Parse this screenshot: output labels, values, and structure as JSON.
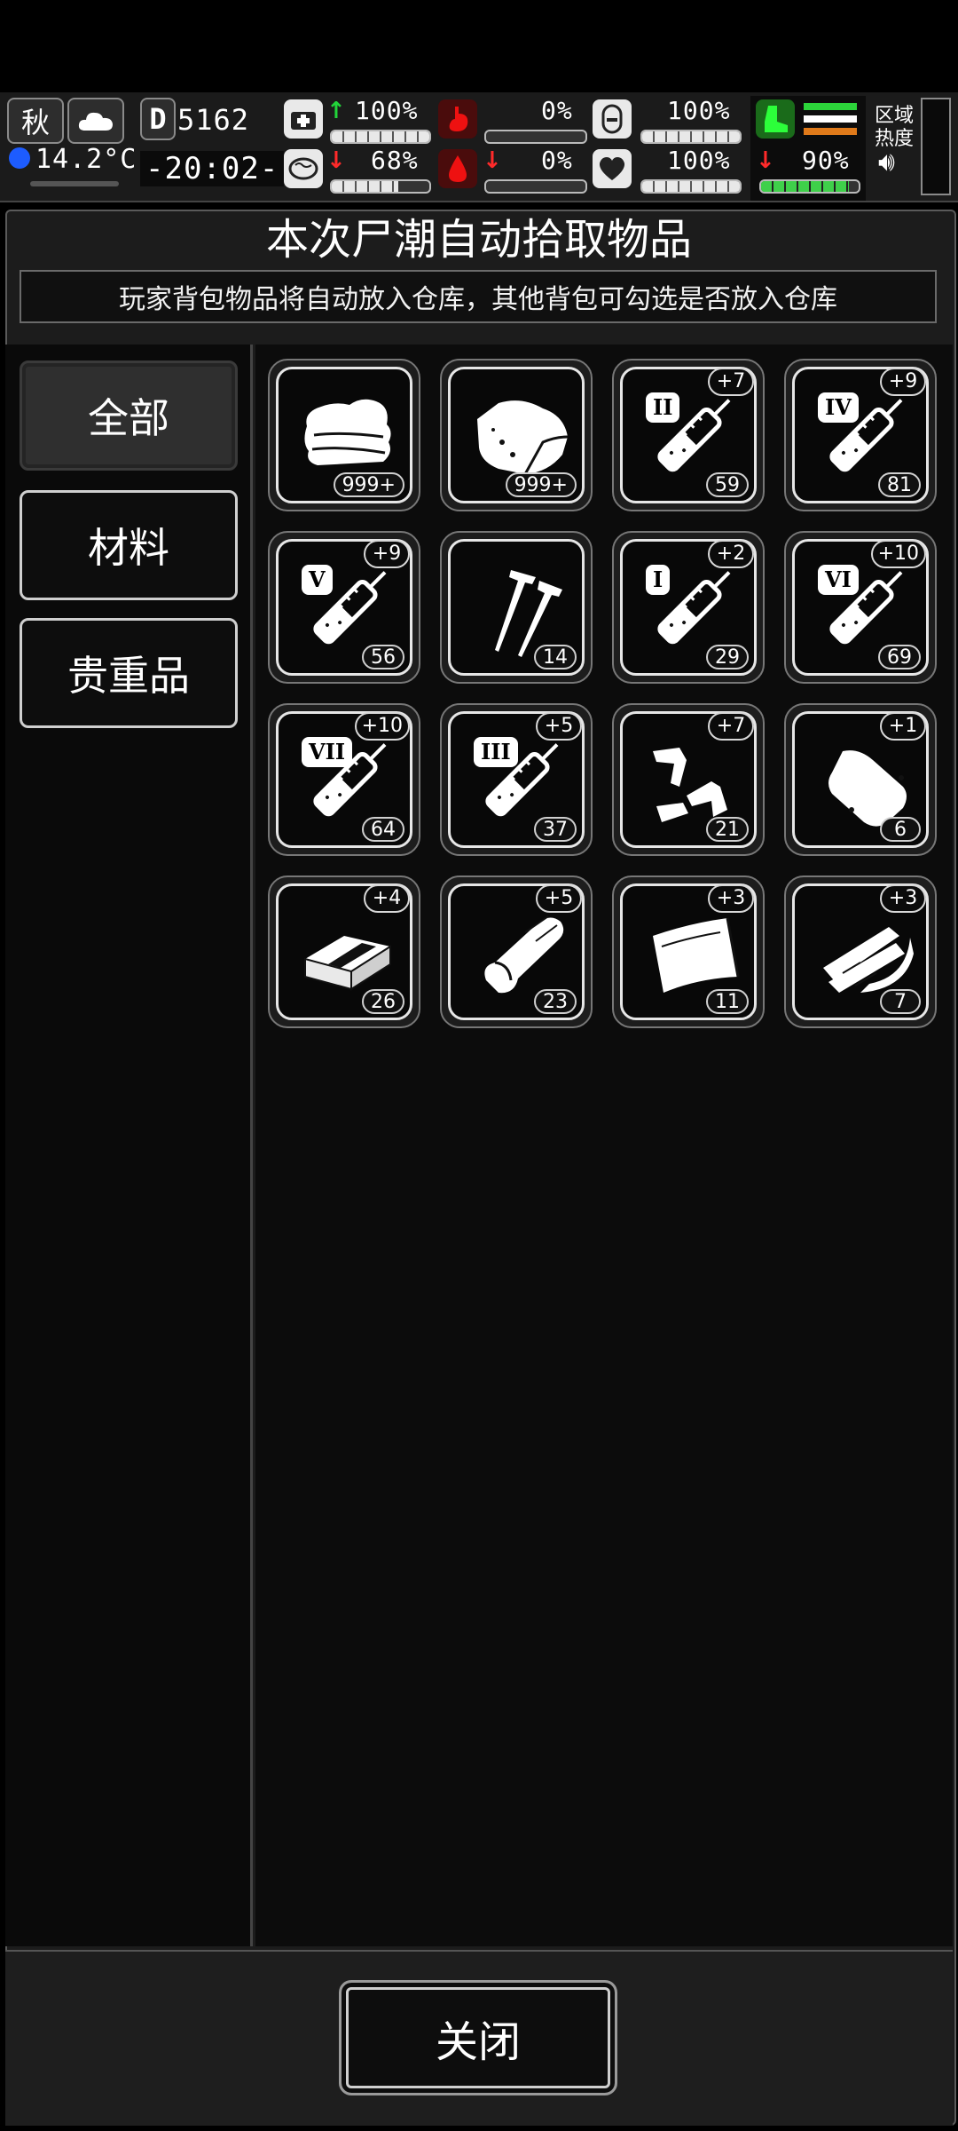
{
  "hud": {
    "season": "秋",
    "temperature": "14.2°C",
    "day_letter": "D",
    "day": "5162",
    "time": "-20:02-",
    "stats": [
      {
        "icon": "health-kit-icon",
        "trend": "up",
        "value": "100%",
        "level": 1.0
      },
      {
        "icon": "stomach-icon",
        "trend": "none",
        "value": "0%",
        "level": 0.0
      },
      {
        "icon": "energy-icon",
        "trend": "none",
        "value": "100%",
        "level": 1.0
      },
      {
        "icon": "brain-icon",
        "trend": "down",
        "value": "68%",
        "level": 0.68
      },
      {
        "icon": "blood-drop-icon",
        "trend": "down",
        "value": "0%",
        "level": 0.0
      },
      {
        "icon": "heart-icon",
        "trend": "none",
        "value": "100%",
        "level": 1.0
      }
    ],
    "stamina": {
      "icon": "boot-icon",
      "trend": "down",
      "value": "90%",
      "level": 0.9
    },
    "region_label": "区域\n热度"
  },
  "panel": {
    "title": "本次尸潮自动拾取物品",
    "subtitle": "玩家背包物品将自动放入仓库，其他背包可勾选是否放入仓库"
  },
  "sidebar": {
    "tabs": [
      {
        "label": "全部",
        "active": true
      },
      {
        "label": "材料",
        "active": false
      },
      {
        "label": "贵重品",
        "active": false
      }
    ]
  },
  "items": [
    {
      "icon": "cloth-icon",
      "count": "999+",
      "bonus": "",
      "tier": ""
    },
    {
      "icon": "meat-icon",
      "count": "999+",
      "bonus": "",
      "tier": ""
    },
    {
      "icon": "syringe-icon",
      "count": "59",
      "bonus": "+7",
      "tier": "II"
    },
    {
      "icon": "syringe-icon",
      "count": "81",
      "bonus": "+9",
      "tier": "IV"
    },
    {
      "icon": "syringe-icon",
      "count": "56",
      "bonus": "+9",
      "tier": "V"
    },
    {
      "icon": "nails-icon",
      "count": "14",
      "bonus": "",
      "tier": ""
    },
    {
      "icon": "syringe-icon",
      "count": "29",
      "bonus": "+2",
      "tier": "I"
    },
    {
      "icon": "syringe-icon",
      "count": "69",
      "bonus": "+10",
      "tier": "VI"
    },
    {
      "icon": "syringe-icon",
      "count": "64",
      "bonus": "+10",
      "tier": "VII"
    },
    {
      "icon": "syringe-icon",
      "count": "37",
      "bonus": "+5",
      "tier": "III"
    },
    {
      "icon": "scrap-parts-icon",
      "count": "21",
      "bonus": "+7",
      "tier": ""
    },
    {
      "icon": "pouch-icon",
      "count": "6",
      "bonus": "+1",
      "tier": ""
    },
    {
      "icon": "ingot-icon",
      "count": "26",
      "bonus": "+4",
      "tier": ""
    },
    {
      "icon": "leather-roll-icon",
      "count": "23",
      "bonus": "+5",
      "tier": ""
    },
    {
      "icon": "sheet-icon",
      "count": "11",
      "bonus": "+3",
      "tier": ""
    },
    {
      "icon": "wood-planks-icon",
      "count": "7",
      "bonus": "+3",
      "tier": ""
    }
  ],
  "footer": {
    "close_label": "关闭"
  }
}
